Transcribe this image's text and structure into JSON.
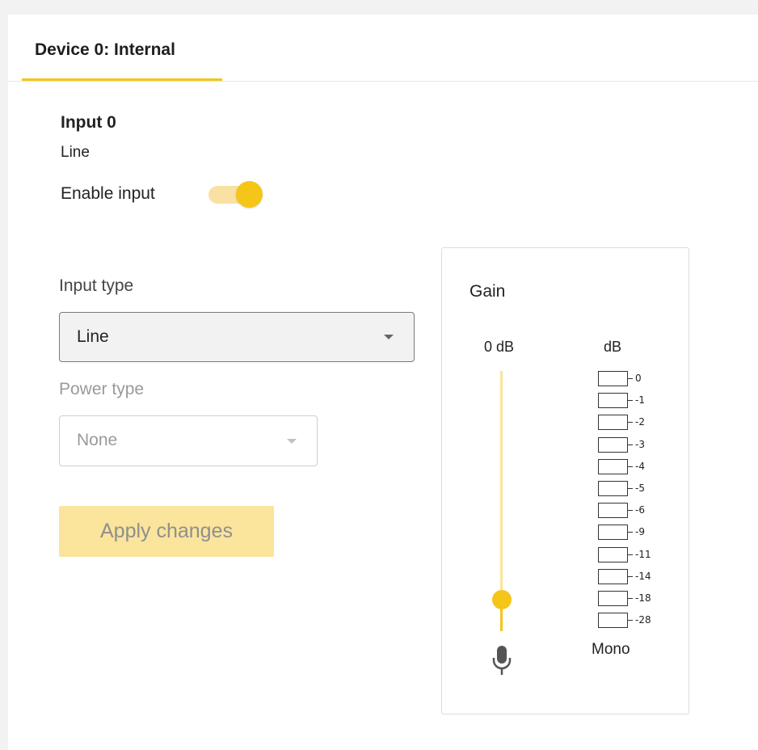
{
  "tabs": [
    {
      "label": "Device 0: Internal",
      "active": true
    }
  ],
  "input": {
    "title": "Input 0",
    "subtitle": "Line",
    "enable_label": "Enable input",
    "enabled": true
  },
  "input_type": {
    "label": "Input type",
    "value": "Line"
  },
  "power_type": {
    "label": "Power type",
    "value": "None",
    "disabled": true
  },
  "apply_button": {
    "label": "Apply changes",
    "disabled": true
  },
  "gain": {
    "title": "Gain",
    "value_label": "0 dB",
    "slider_level_fraction": 0.12,
    "meter_unit": "dB",
    "meter_scale": [
      "0",
      "-1",
      "-2",
      "-3",
      "-4",
      "-5",
      "-6",
      "-9",
      "-11",
      "-14",
      "-18",
      "-28"
    ],
    "channel_label": "Mono",
    "mic_icon": "microphone-icon"
  },
  "colors": {
    "accent": "#f5c518",
    "accent_light": "#fbe49b",
    "toggle_track": "#f8e1a2",
    "disabled_text": "#9a9a9a"
  }
}
